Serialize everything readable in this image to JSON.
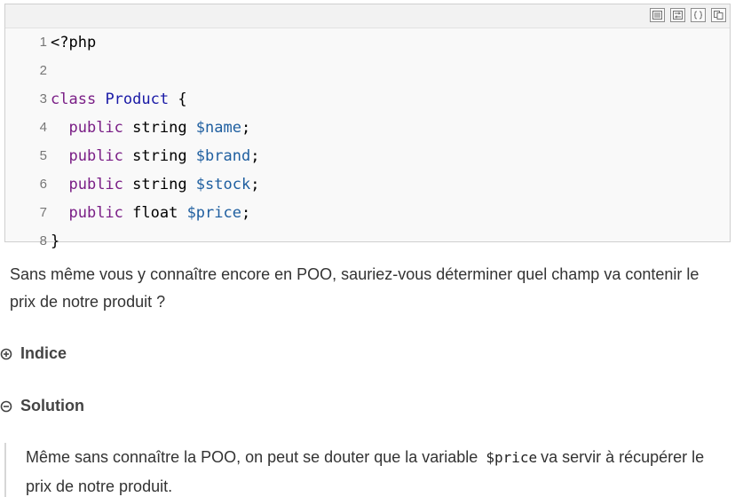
{
  "toolbar": {
    "icons": [
      "view-source-icon",
      "wrap-lines-icon",
      "code-expand-icon",
      "copy-icon"
    ]
  },
  "code": {
    "lines": [
      {
        "n": "1",
        "tokens": [
          {
            "t": "<?php",
            "c": "plain"
          }
        ]
      },
      {
        "n": "2",
        "tokens": []
      },
      {
        "n": "3",
        "tokens": [
          {
            "t": "class",
            "c": "kw"
          },
          {
            "t": " ",
            "c": "plain"
          },
          {
            "t": "Product",
            "c": "cls"
          },
          {
            "t": " {",
            "c": "plain"
          }
        ]
      },
      {
        "n": "4",
        "tokens": [
          {
            "t": "  ",
            "c": "plain"
          },
          {
            "t": "public",
            "c": "kw"
          },
          {
            "t": " string ",
            "c": "plain"
          },
          {
            "t": "$name",
            "c": "var"
          },
          {
            "t": ";",
            "c": "plain"
          }
        ]
      },
      {
        "n": "5",
        "tokens": [
          {
            "t": "  ",
            "c": "plain"
          },
          {
            "t": "public",
            "c": "kw"
          },
          {
            "t": " string ",
            "c": "plain"
          },
          {
            "t": "$brand",
            "c": "var"
          },
          {
            "t": ";",
            "c": "plain"
          }
        ]
      },
      {
        "n": "6",
        "tokens": [
          {
            "t": "  ",
            "c": "plain"
          },
          {
            "t": "public",
            "c": "kw"
          },
          {
            "t": " string ",
            "c": "plain"
          },
          {
            "t": "$stock",
            "c": "var"
          },
          {
            "t": ";",
            "c": "plain"
          }
        ]
      },
      {
        "n": "7",
        "tokens": [
          {
            "t": "  ",
            "c": "plain"
          },
          {
            "t": "public",
            "c": "kw"
          },
          {
            "t": " float ",
            "c": "plain"
          },
          {
            "t": "$price",
            "c": "var"
          },
          {
            "t": ";",
            "c": "plain"
          }
        ]
      },
      {
        "n": "8",
        "tokens": [
          {
            "t": "}",
            "c": "plain"
          }
        ]
      }
    ]
  },
  "question": "Sans même vous y connaître encore en POO, sauriez-vous déterminer quel champ va contenir le prix de notre produit ?",
  "toggles": {
    "indice": "Indice",
    "solution": "Solution"
  },
  "solution_text": {
    "before": "Même sans connaître la POO, on peut se douter que la variable",
    "code": "$price",
    "after": "va servir à récupérer le prix de notre produit."
  },
  "colors": {
    "keyword": "#7a1e86",
    "class_name": "#1a1aa6",
    "variable": "#1f5fa0"
  }
}
